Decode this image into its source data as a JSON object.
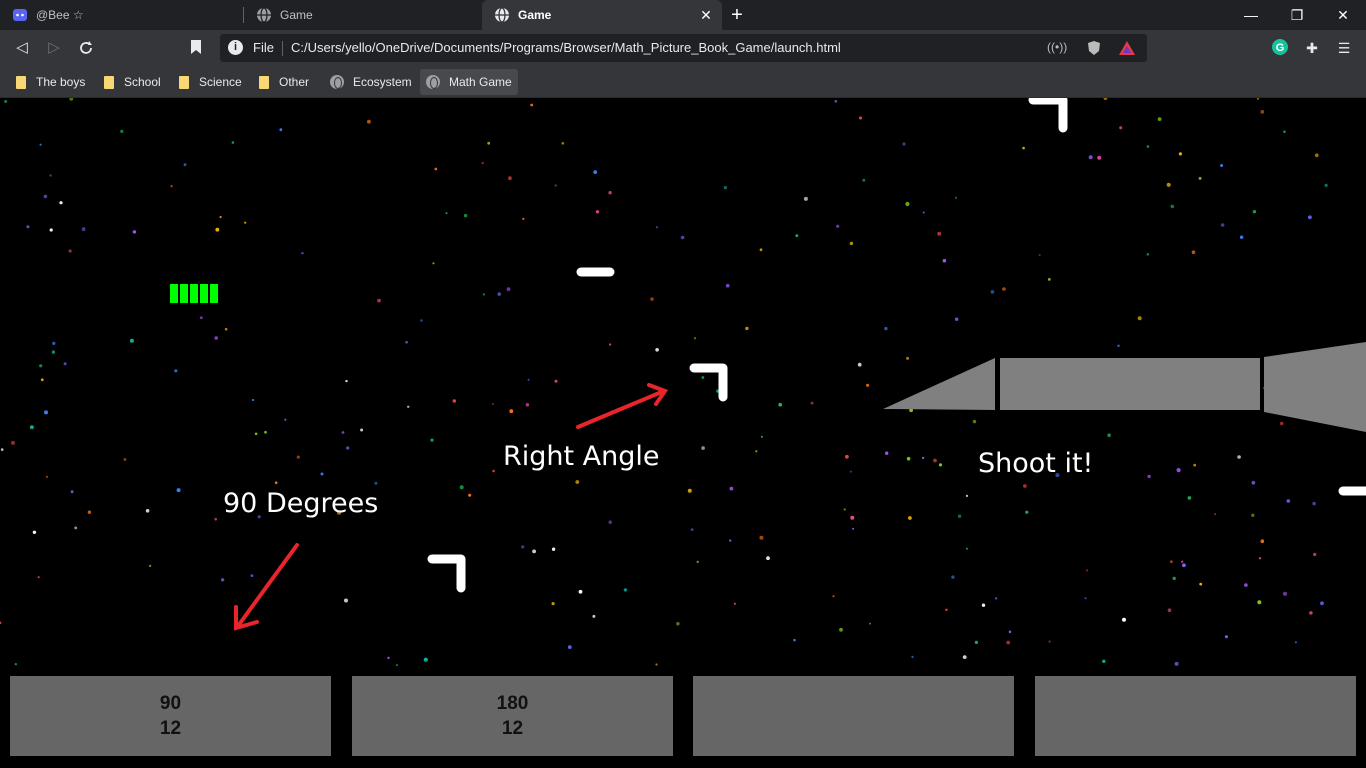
{
  "tabs": [
    {
      "title": "@Bee ☆",
      "icon": "discord-icon"
    },
    {
      "title": "Game",
      "icon": "globe-icon"
    },
    {
      "title": "Game",
      "icon": "globe-icon",
      "active": true
    }
  ],
  "window_controls": {
    "minimize": "—",
    "maximize": "❐",
    "close": "✕"
  },
  "toolbar": {
    "scheme": "File",
    "url": "C:/Users/yello/OneDrive/Documents/Programs/Browser/Math_Picture_Book_Game/launch.html"
  },
  "bookmarks": [
    {
      "label": "The boys",
      "type": "folder"
    },
    {
      "label": "School",
      "type": "folder"
    },
    {
      "label": "Science",
      "type": "folder"
    },
    {
      "label": "Other",
      "type": "folder"
    },
    {
      "label": "Ecosystem",
      "type": "page"
    },
    {
      "label": "Math Game",
      "type": "page"
    }
  ],
  "game": {
    "health_segments": 5,
    "labels": {
      "right_angle": "Right Angle",
      "ninety_degrees": "90 Degrees",
      "shoot_it": "Shoot it!"
    },
    "answers": [
      {
        "line1": "90",
        "line2": "12"
      },
      {
        "line1": "180",
        "line2": "12"
      },
      {
        "line1": "",
        "line2": ""
      },
      {
        "line1": "",
        "line2": ""
      }
    ],
    "colors": {
      "health": "#00ff00",
      "arrow": "#e8252b",
      "ship": "#808080",
      "answer_box": "#666666"
    }
  }
}
